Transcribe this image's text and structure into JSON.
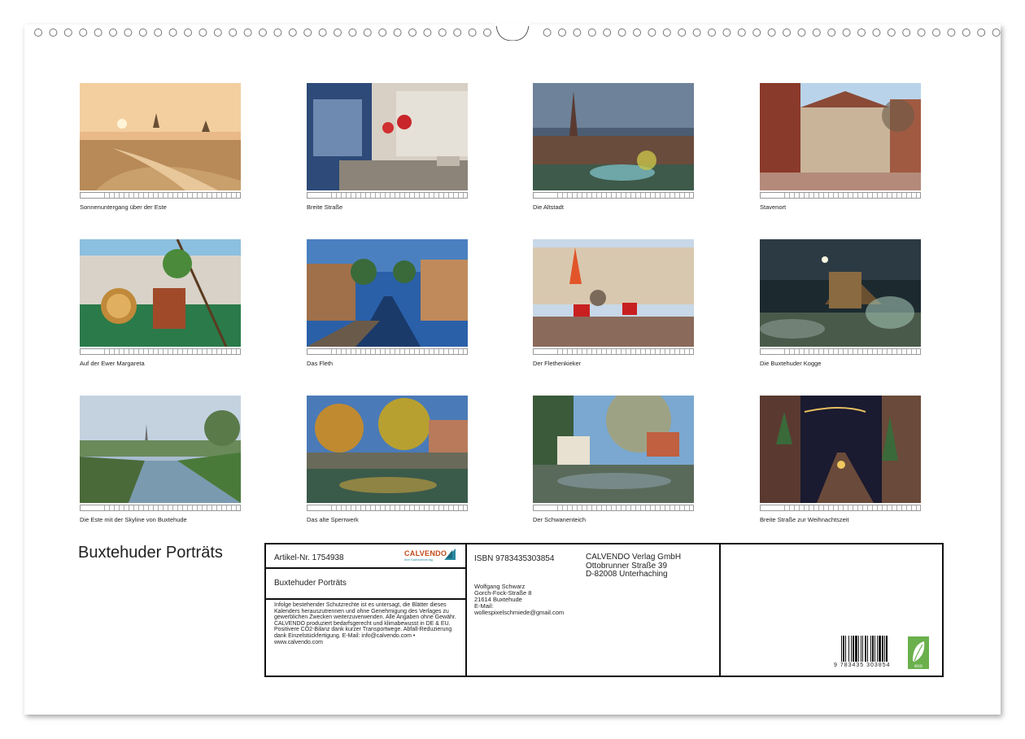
{
  "calendar": {
    "title": "Buxtehuder Porträts",
    "photos": [
      {
        "caption": "Sonnenuntergang über der Este"
      },
      {
        "caption": "Breite Straße"
      },
      {
        "caption": "Die Altstadt"
      },
      {
        "caption": "Stavenort"
      },
      {
        "caption": "Auf der Ewer Margareta"
      },
      {
        "caption": "Das Fleth"
      },
      {
        "caption": "Der Flethenkieker"
      },
      {
        "caption": "Die Buxtehuder Kogge"
      },
      {
        "caption": "Die Este mit der Skyline von Buxtehude"
      },
      {
        "caption": "Das alte Sperrwerk"
      },
      {
        "caption": "Der Schwanenteich"
      },
      {
        "caption": "Breite Straße zur Weihnachtszeit"
      }
    ]
  },
  "info": {
    "article": "Artikel-Nr. 1754938",
    "logo": "CALVENDO",
    "logo_sub": "Ihre Kalenderverlag",
    "box_title": "Buxtehuder Porträts",
    "legal": "Infolge bestehender Schutzrechte ist es untersagt, die Blätter dieses Kalenders herauszutrennen und ohne Genehmigung des Verlages zu gewerblichen Zwecken weiterzuverwenden. Alle Angaben ohne Gewähr. CALVENDO produziert bedarfsgerecht und klimabewusst in DE & EU. Positivere CO2-Bilanz dank kurzer Transportwege. Abfall-Reduzierung dank Einzelstückfertigung. E-Mail: info@calvendo.com • www.calvendo.com",
    "isbn": "ISBN 9783435303854",
    "publisher": [
      "CALVENDO Verlag GmbH",
      "Ottobrunner Straße 39",
      "D-82008 Unterhaching"
    ],
    "author": [
      "Wolfgang Schwarz",
      "Gorch-Fock-Straße 8",
      "21614 Buxtehude",
      "E-Mail:",
      "wollespixelschmiede@gmail.com"
    ],
    "barcode_number": "9 783435 303854",
    "eco_label": "eco"
  }
}
